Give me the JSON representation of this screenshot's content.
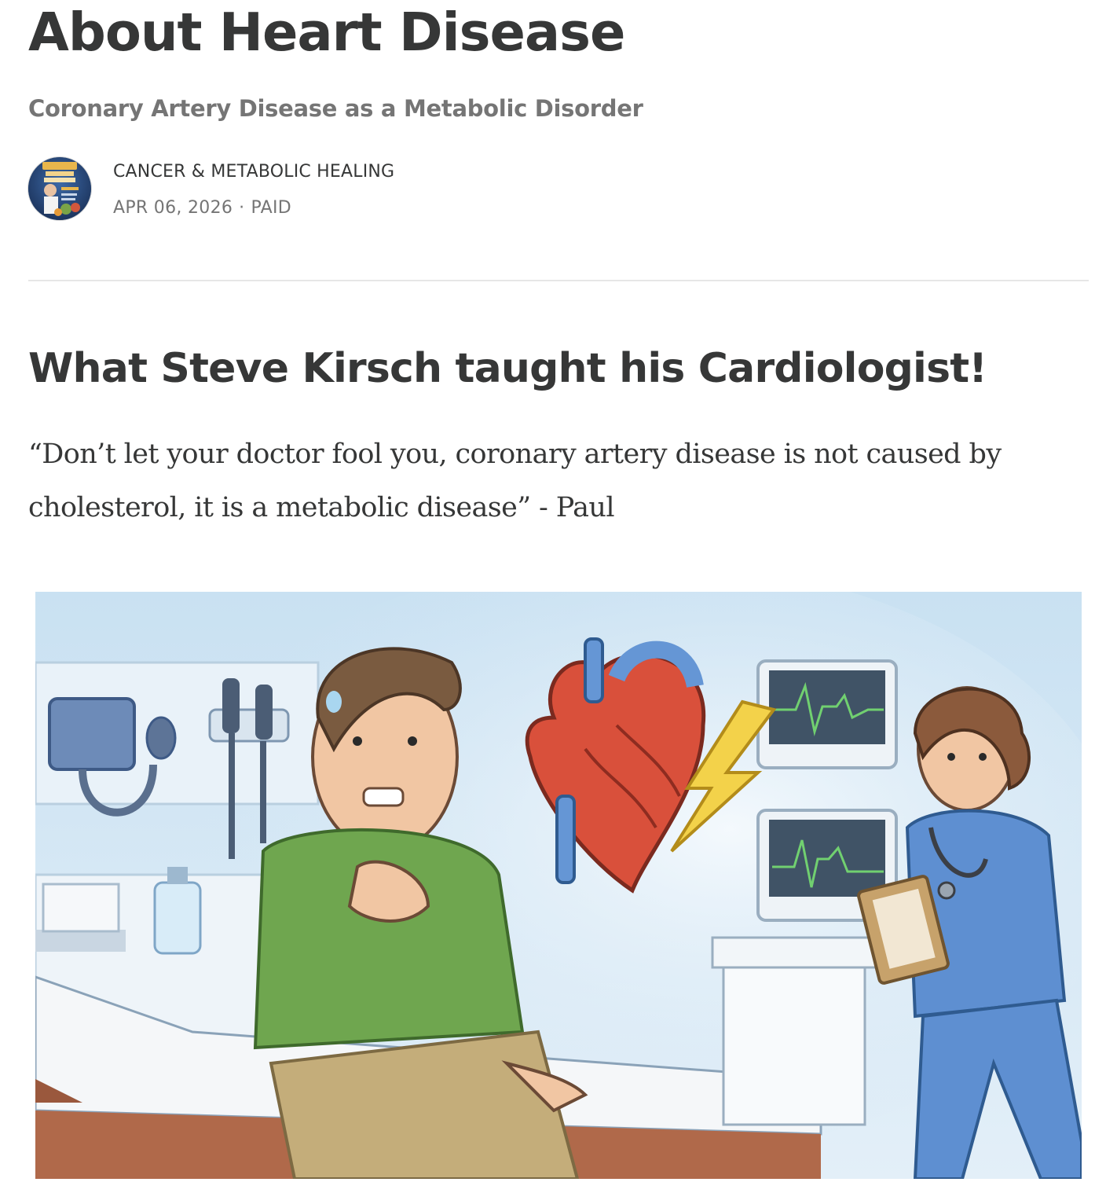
{
  "post": {
    "title": "About Heart Disease",
    "subtitle": "Coronary Artery Disease as a Metabolic Disorder"
  },
  "byline": {
    "publication": "CANCER & METABOLIC HEALING",
    "date": "APR 06, 2026",
    "separator": "·",
    "access": "PAID"
  },
  "body": {
    "heading": "What Steve Kirsch taught his Cardiologist!",
    "quote": "“Don’t let your doctor fool you, coronary artery disease is not caused by cholesterol, it is a metabolic disease” - Paul"
  },
  "colors": {
    "text": "#363737",
    "muted": "#757575",
    "divider": "#e6e6e6"
  }
}
